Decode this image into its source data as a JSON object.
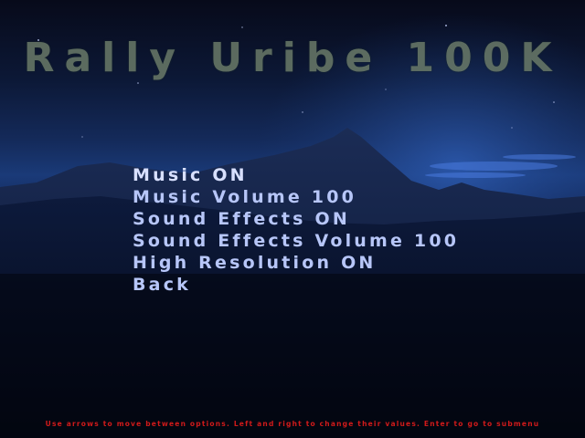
{
  "game": {
    "title": "Rally Uribe 100K"
  },
  "menu": {
    "items": [
      {
        "label": "Music ON"
      },
      {
        "label": "Music Volume 100"
      },
      {
        "label": "Sound Effects ON"
      },
      {
        "label": "Sound Effects Volume 100"
      },
      {
        "label": "High Resolution ON"
      },
      {
        "label": "Back"
      }
    ],
    "selected_index": 0
  },
  "footer": {
    "hint": "Use arrows to move between options. Left and right to change their values. Enter to go to submenu"
  },
  "colors": {
    "title": "#6a7a68",
    "menu_text": "#b7c6f8",
    "hint_text": "#d01a1a",
    "sky_glow": "#1a3a78"
  }
}
